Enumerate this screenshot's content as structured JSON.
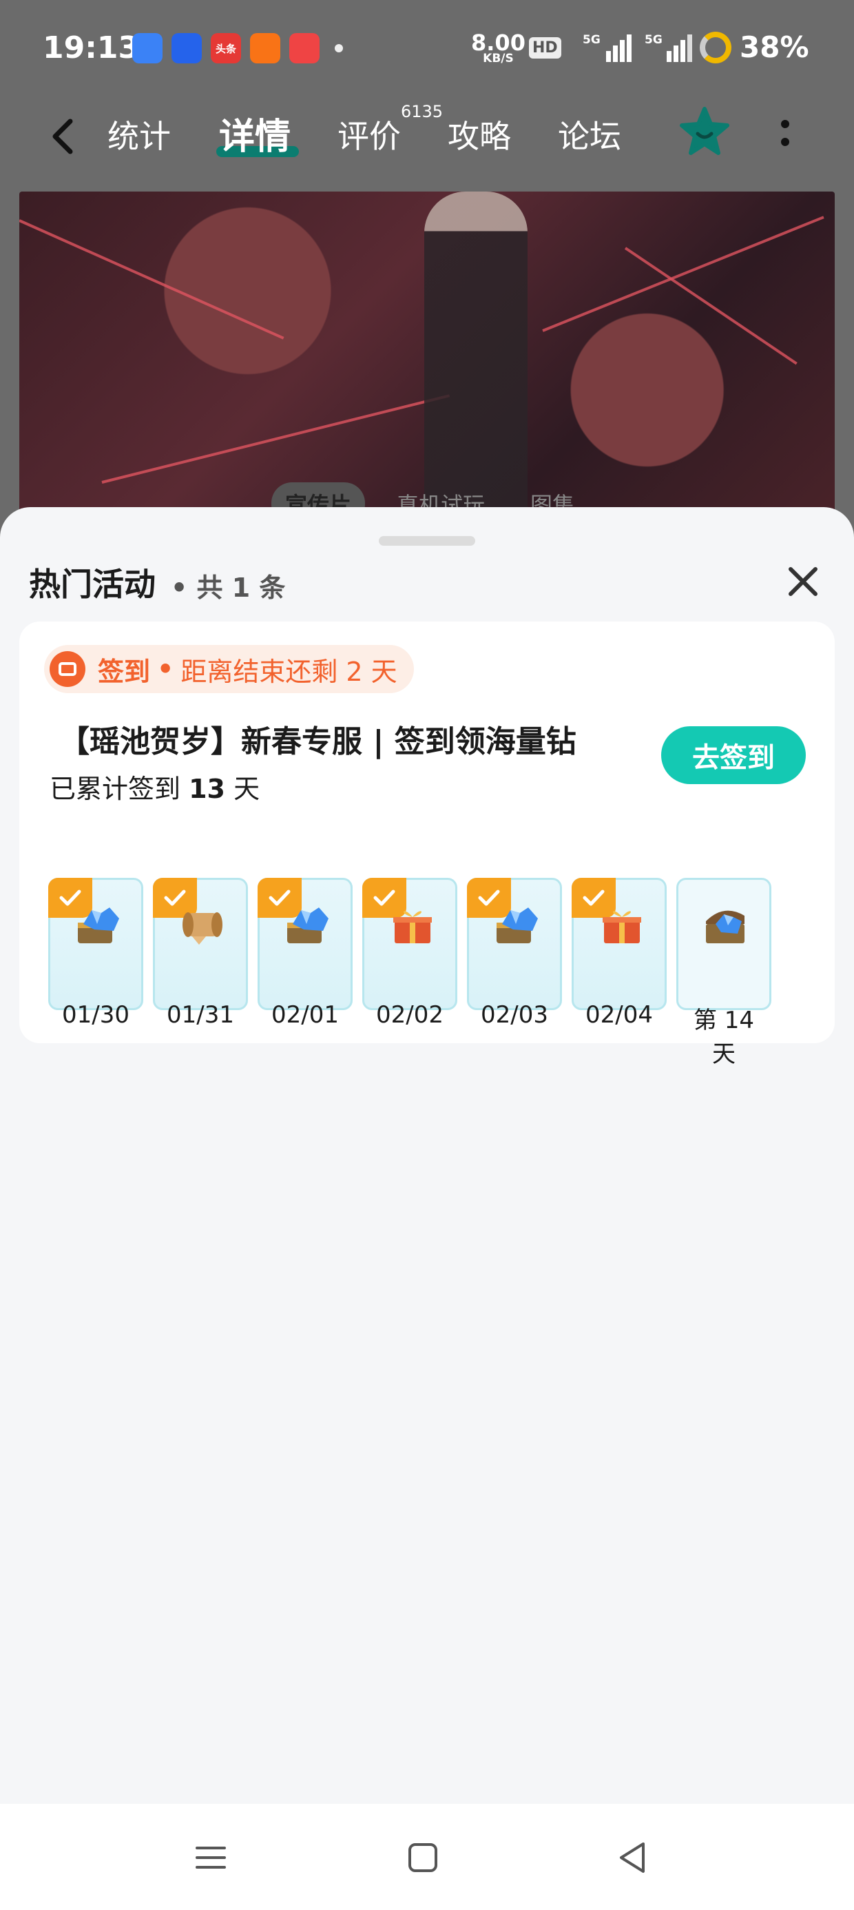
{
  "status_bar": {
    "time": "19:13",
    "net_speed": "8.00",
    "net_unit": "KB/S",
    "hd": "HD",
    "signal1": "5G",
    "signal2": "5G",
    "battery": "38%",
    "app_icons": [
      {
        "name": "app-icon-1",
        "color": "#3b82f6",
        "text": ""
      },
      {
        "name": "app-icon-2",
        "color": "#2563eb",
        "text": ""
      },
      {
        "name": "app-icon-toutiao",
        "color": "#e53935",
        "text": "头条"
      },
      {
        "name": "app-icon-4",
        "color": "#f97316",
        "text": ""
      },
      {
        "name": "app-icon-5",
        "color": "#ef4444",
        "text": ""
      }
    ]
  },
  "nav": {
    "tabs": [
      {
        "label": "统计"
      },
      {
        "label": "详情"
      },
      {
        "label": "评价"
      },
      {
        "label": "攻略"
      },
      {
        "label": "论坛"
      }
    ],
    "review_count": "6135"
  },
  "hero": {
    "video_tabs": [
      "宣传片",
      "真机试玩",
      "图集"
    ]
  },
  "sheet": {
    "title": "热门活动",
    "count": "• 共 1 条"
  },
  "activity": {
    "tag": "签到",
    "separator": "•",
    "remaining": "距离结束还剩 2 天",
    "title": "【瑶池贺岁】新春专服 | 签到领海量钻",
    "progress_prefix": "已累计签到",
    "progress_days": "13",
    "progress_suffix": "天",
    "button": "去签到",
    "days": [
      {
        "label": "01/30",
        "reward": "diamond-chest-icon",
        "checked": true
      },
      {
        "label": "01/31",
        "reward": "scroll-icon",
        "checked": true
      },
      {
        "label": "02/01",
        "reward": "diamond-chest-icon",
        "checked": true
      },
      {
        "label": "02/02",
        "reward": "gift-box-icon",
        "checked": true
      },
      {
        "label": "02/03",
        "reward": "diamond-chest-icon",
        "checked": true
      },
      {
        "label": "02/04",
        "reward": "gift-box-icon",
        "checked": true
      },
      {
        "label": "第 14 天",
        "reward": "treasure-chest-icon",
        "checked": false
      }
    ]
  },
  "colors": {
    "accent": "#14c9b3",
    "tag": "#f2622d",
    "check": "#f6a21e",
    "nav_underline": "#0b7d70"
  }
}
